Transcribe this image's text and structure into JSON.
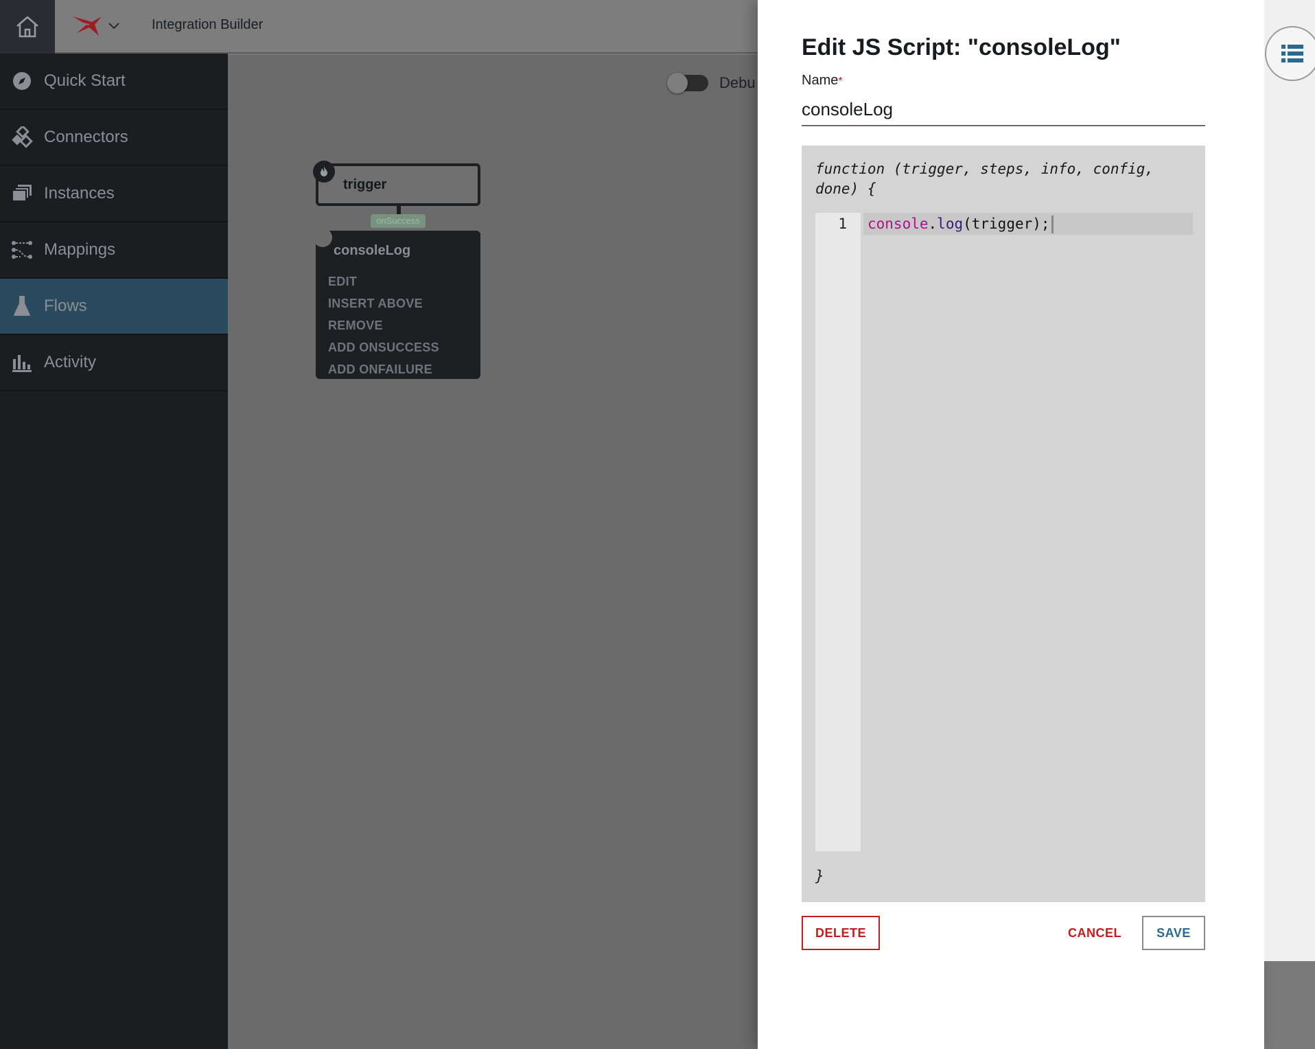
{
  "header": {
    "app_title": "Integration Builder"
  },
  "sidebar": {
    "items": [
      {
        "label": "Quick Start",
        "icon": "compass-icon"
      },
      {
        "label": "Connectors",
        "icon": "connectors-icon"
      },
      {
        "label": "Instances",
        "icon": "layers-icon"
      },
      {
        "label": "Mappings",
        "icon": "mappings-icon"
      },
      {
        "label": "Flows",
        "icon": "flask-icon",
        "active": true
      },
      {
        "label": "Activity",
        "icon": "bar-chart-icon"
      }
    ]
  },
  "canvas": {
    "debug_label": "Debu",
    "trigger_node": {
      "label": "trigger"
    },
    "connector_tag": "onSuccess",
    "script_node": {
      "label": "consoleLog",
      "menu": [
        "EDIT",
        "INSERT ABOVE",
        "REMOVE",
        "ADD ONSUCCESS",
        "ADD ONFAILURE"
      ]
    }
  },
  "panel": {
    "title": "Edit JS Script: \"consoleLog\"",
    "name_label": "Name",
    "required_mark": "*",
    "name_value": "consoleLog",
    "function_signature": "function (trigger, steps, info, config, done) {",
    "function_close": "}",
    "code_lines": [
      {
        "number": "1",
        "object": "console",
        "dot": ".",
        "method": "log",
        "rest": "(trigger);"
      }
    ],
    "buttons": {
      "delete": "DELETE",
      "cancel": "CANCEL",
      "save": "SAVE"
    }
  },
  "colors": {
    "sidebar_bg": "#1b1d21",
    "sidebar_active": "#2a4a5e",
    "danger": "#c21c1c",
    "save_text": "#2a6a92",
    "brand_red": "#b5202a"
  }
}
